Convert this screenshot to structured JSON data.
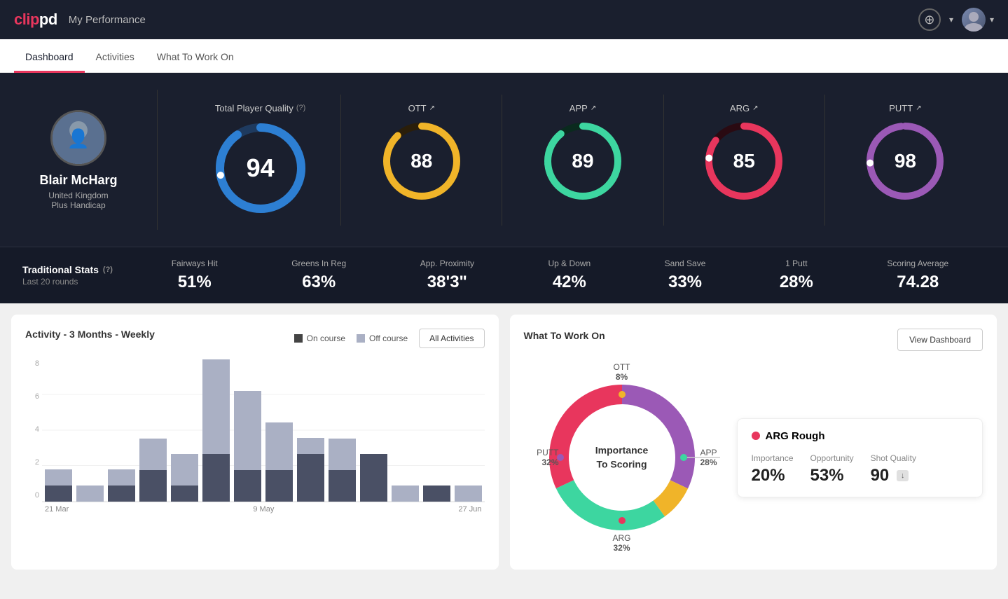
{
  "header": {
    "logo": "clippd",
    "title": "My Performance",
    "add_label": "+",
    "chevron": "▾"
  },
  "nav": {
    "tabs": [
      {
        "label": "Dashboard",
        "active": true
      },
      {
        "label": "Activities",
        "active": false
      },
      {
        "label": "What To Work On",
        "active": false
      }
    ]
  },
  "hero": {
    "player": {
      "name": "Blair McHarg",
      "country": "United Kingdom",
      "handicap": "Plus Handicap"
    },
    "tpq": {
      "label": "Total Player Quality",
      "value": "94",
      "color": "#2d7fd3"
    },
    "scores": [
      {
        "label": "OTT",
        "value": "88",
        "color": "#f0b429",
        "pct": 88
      },
      {
        "label": "APP",
        "value": "89",
        "color": "#3dd6a0",
        "pct": 89
      },
      {
        "label": "ARG",
        "value": "85",
        "color": "#e8365d",
        "pct": 85
      },
      {
        "label": "PUTT",
        "value": "98",
        "color": "#9b59b6",
        "pct": 98
      }
    ]
  },
  "stats": {
    "label": "Traditional Stats",
    "sublabel": "Last 20 rounds",
    "items": [
      {
        "label": "Fairways Hit",
        "value": "51%"
      },
      {
        "label": "Greens In Reg",
        "value": "63%"
      },
      {
        "label": "App. Proximity",
        "value": "38'3\""
      },
      {
        "label": "Up & Down",
        "value": "42%"
      },
      {
        "label": "Sand Save",
        "value": "33%"
      },
      {
        "label": "1 Putt",
        "value": "28%"
      },
      {
        "label": "Scoring Average",
        "value": "74.28"
      }
    ]
  },
  "activity_chart": {
    "title": "Activity - 3 Months - Weekly",
    "legend": {
      "on_course": "On course",
      "off_course": "Off course"
    },
    "all_button": "All Activities",
    "bars": [
      {
        "on": 1,
        "off": 1
      },
      {
        "on": 0,
        "off": 1
      },
      {
        "on": 1,
        "off": 1
      },
      {
        "on": 2,
        "off": 2
      },
      {
        "on": 1,
        "off": 2
      },
      {
        "on": 3,
        "off": 6
      },
      {
        "on": 2,
        "off": 5
      },
      {
        "on": 2,
        "off": 3
      },
      {
        "on": 3,
        "off": 1
      },
      {
        "on": 2,
        "off": 2
      },
      {
        "on": 3,
        "off": 0
      },
      {
        "on": 0,
        "off": 1
      },
      {
        "on": 1,
        "off": 0
      },
      {
        "on": 0,
        "off": 1
      }
    ],
    "x_labels": [
      "21 Mar",
      "9 May",
      "27 Jun"
    ],
    "y_max": 8
  },
  "what_to_work_on": {
    "title": "What To Work On",
    "view_button": "View Dashboard",
    "center_text": "Importance\nTo Scoring",
    "segments": [
      {
        "label": "OTT",
        "pct": "8%",
        "color": "#f0b429"
      },
      {
        "label": "APP",
        "pct": "28%",
        "color": "#3dd6a0"
      },
      {
        "label": "ARG",
        "pct": "32%",
        "color": "#e8365d"
      },
      {
        "label": "PUTT",
        "pct": "32%",
        "color": "#9b59b6"
      }
    ],
    "detail": {
      "title": "ARG Rough",
      "metrics": [
        {
          "label": "Importance",
          "value": "20%"
        },
        {
          "label": "Opportunity",
          "value": "53%"
        },
        {
          "label": "Shot Quality",
          "value": "90",
          "badge": "↓"
        }
      ]
    }
  }
}
